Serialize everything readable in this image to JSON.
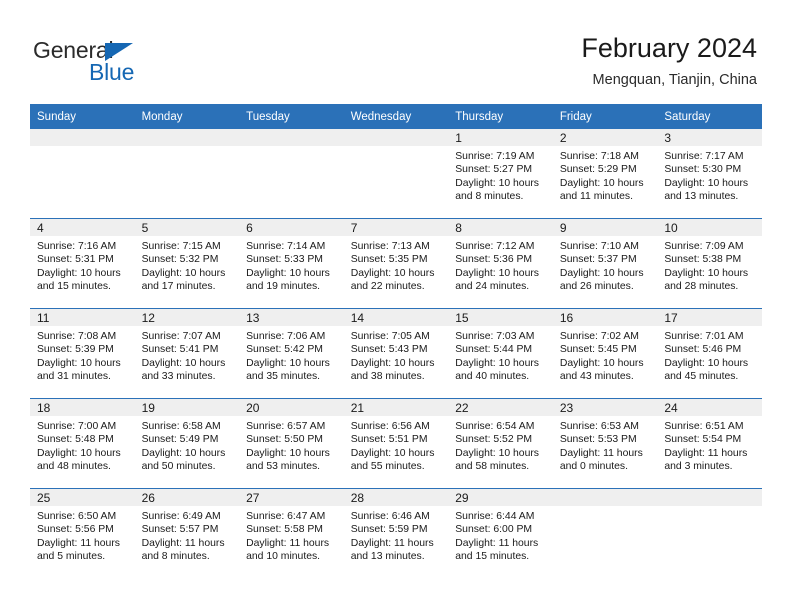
{
  "brand": {
    "name_part1": "General",
    "name_part2": "Blue",
    "triangle_icon": "brand-triangle-icon",
    "colors": {
      "blue": "#1567b3",
      "dark": "#2b2b2b"
    }
  },
  "header": {
    "title": "February 2024",
    "subtitle": "Mengquan, Tianjin, China"
  },
  "theme": {
    "header_blue": "#2b71b8",
    "band_gray": "#efefef",
    "text": "#1a1a1a"
  },
  "weekdays": [
    "Sunday",
    "Monday",
    "Tuesday",
    "Wednesday",
    "Thursday",
    "Friday",
    "Saturday"
  ],
  "weeks": [
    [
      {
        "empty": true
      },
      {
        "empty": true
      },
      {
        "empty": true
      },
      {
        "empty": true
      },
      {
        "day": "1",
        "sunrise": "Sunrise: 7:19 AM",
        "sunset": "Sunset: 5:27 PM",
        "daylight": "Daylight: 10 hours and 8 minutes."
      },
      {
        "day": "2",
        "sunrise": "Sunrise: 7:18 AM",
        "sunset": "Sunset: 5:29 PM",
        "daylight": "Daylight: 10 hours and 11 minutes."
      },
      {
        "day": "3",
        "sunrise": "Sunrise: 7:17 AM",
        "sunset": "Sunset: 5:30 PM",
        "daylight": "Daylight: 10 hours and 13 minutes."
      }
    ],
    [
      {
        "day": "4",
        "sunrise": "Sunrise: 7:16 AM",
        "sunset": "Sunset: 5:31 PM",
        "daylight": "Daylight: 10 hours and 15 minutes."
      },
      {
        "day": "5",
        "sunrise": "Sunrise: 7:15 AM",
        "sunset": "Sunset: 5:32 PM",
        "daylight": "Daylight: 10 hours and 17 minutes."
      },
      {
        "day": "6",
        "sunrise": "Sunrise: 7:14 AM",
        "sunset": "Sunset: 5:33 PM",
        "daylight": "Daylight: 10 hours and 19 minutes."
      },
      {
        "day": "7",
        "sunrise": "Sunrise: 7:13 AM",
        "sunset": "Sunset: 5:35 PM",
        "daylight": "Daylight: 10 hours and 22 minutes."
      },
      {
        "day": "8",
        "sunrise": "Sunrise: 7:12 AM",
        "sunset": "Sunset: 5:36 PM",
        "daylight": "Daylight: 10 hours and 24 minutes."
      },
      {
        "day": "9",
        "sunrise": "Sunrise: 7:10 AM",
        "sunset": "Sunset: 5:37 PM",
        "daylight": "Daylight: 10 hours and 26 minutes."
      },
      {
        "day": "10",
        "sunrise": "Sunrise: 7:09 AM",
        "sunset": "Sunset: 5:38 PM",
        "daylight": "Daylight: 10 hours and 28 minutes."
      }
    ],
    [
      {
        "day": "11",
        "sunrise": "Sunrise: 7:08 AM",
        "sunset": "Sunset: 5:39 PM",
        "daylight": "Daylight: 10 hours and 31 minutes."
      },
      {
        "day": "12",
        "sunrise": "Sunrise: 7:07 AM",
        "sunset": "Sunset: 5:41 PM",
        "daylight": "Daylight: 10 hours and 33 minutes."
      },
      {
        "day": "13",
        "sunrise": "Sunrise: 7:06 AM",
        "sunset": "Sunset: 5:42 PM",
        "daylight": "Daylight: 10 hours and 35 minutes."
      },
      {
        "day": "14",
        "sunrise": "Sunrise: 7:05 AM",
        "sunset": "Sunset: 5:43 PM",
        "daylight": "Daylight: 10 hours and 38 minutes."
      },
      {
        "day": "15",
        "sunrise": "Sunrise: 7:03 AM",
        "sunset": "Sunset: 5:44 PM",
        "daylight": "Daylight: 10 hours and 40 minutes."
      },
      {
        "day": "16",
        "sunrise": "Sunrise: 7:02 AM",
        "sunset": "Sunset: 5:45 PM",
        "daylight": "Daylight: 10 hours and 43 minutes."
      },
      {
        "day": "17",
        "sunrise": "Sunrise: 7:01 AM",
        "sunset": "Sunset: 5:46 PM",
        "daylight": "Daylight: 10 hours and 45 minutes."
      }
    ],
    [
      {
        "day": "18",
        "sunrise": "Sunrise: 7:00 AM",
        "sunset": "Sunset: 5:48 PM",
        "daylight": "Daylight: 10 hours and 48 minutes."
      },
      {
        "day": "19",
        "sunrise": "Sunrise: 6:58 AM",
        "sunset": "Sunset: 5:49 PM",
        "daylight": "Daylight: 10 hours and 50 minutes."
      },
      {
        "day": "20",
        "sunrise": "Sunrise: 6:57 AM",
        "sunset": "Sunset: 5:50 PM",
        "daylight": "Daylight: 10 hours and 53 minutes."
      },
      {
        "day": "21",
        "sunrise": "Sunrise: 6:56 AM",
        "sunset": "Sunset: 5:51 PM",
        "daylight": "Daylight: 10 hours and 55 minutes."
      },
      {
        "day": "22",
        "sunrise": "Sunrise: 6:54 AM",
        "sunset": "Sunset: 5:52 PM",
        "daylight": "Daylight: 10 hours and 58 minutes."
      },
      {
        "day": "23",
        "sunrise": "Sunrise: 6:53 AM",
        "sunset": "Sunset: 5:53 PM",
        "daylight": "Daylight: 11 hours and 0 minutes."
      },
      {
        "day": "24",
        "sunrise": "Sunrise: 6:51 AM",
        "sunset": "Sunset: 5:54 PM",
        "daylight": "Daylight: 11 hours and 3 minutes."
      }
    ],
    [
      {
        "day": "25",
        "sunrise": "Sunrise: 6:50 AM",
        "sunset": "Sunset: 5:56 PM",
        "daylight": "Daylight: 11 hours and 5 minutes."
      },
      {
        "day": "26",
        "sunrise": "Sunrise: 6:49 AM",
        "sunset": "Sunset: 5:57 PM",
        "daylight": "Daylight: 11 hours and 8 minutes."
      },
      {
        "day": "27",
        "sunrise": "Sunrise: 6:47 AM",
        "sunset": "Sunset: 5:58 PM",
        "daylight": "Daylight: 11 hours and 10 minutes."
      },
      {
        "day": "28",
        "sunrise": "Sunrise: 6:46 AM",
        "sunset": "Sunset: 5:59 PM",
        "daylight": "Daylight: 11 hours and 13 minutes."
      },
      {
        "day": "29",
        "sunrise": "Sunrise: 6:44 AM",
        "sunset": "Sunset: 6:00 PM",
        "daylight": "Daylight: 11 hours and 15 minutes."
      },
      {
        "empty": true
      },
      {
        "empty": true
      }
    ]
  ]
}
